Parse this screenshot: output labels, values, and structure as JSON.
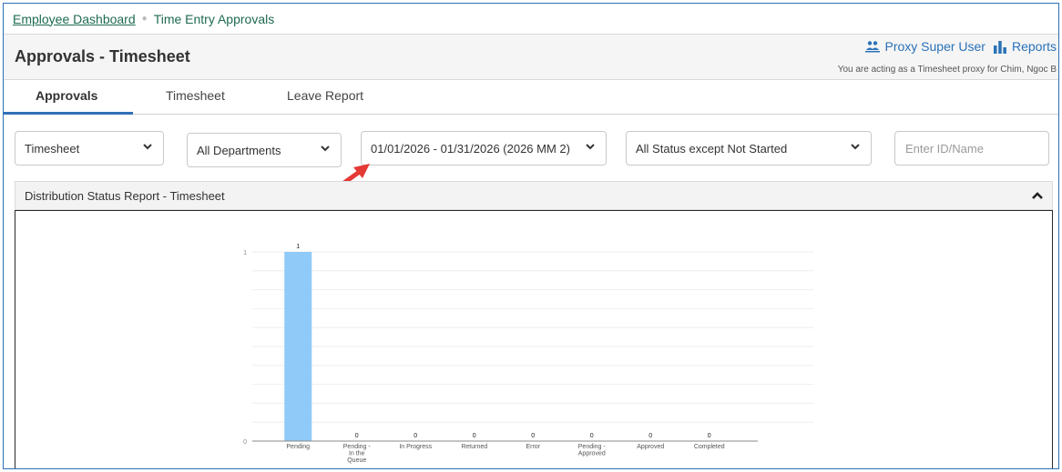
{
  "breadcrumb": {
    "items": [
      {
        "label": "Employee Dashboard"
      },
      {
        "label": "Time Entry Approvals"
      }
    ]
  },
  "header": {
    "title": "Approvals - Timesheet",
    "proxy_label": "Proxy Super User",
    "reports_label": "Reports",
    "proxy_note": "You are acting as a Timesheet proxy for Chim, Ngoc B",
    "icons": [
      "proxy-user-icon",
      "reports-chart-icon"
    ]
  },
  "tabs": [
    {
      "label": "Approvals",
      "active": true
    },
    {
      "label": "Timesheet",
      "active": false
    },
    {
      "label": "Leave Report",
      "active": false
    }
  ],
  "filters": {
    "type": "Timesheet",
    "department": "All Departments",
    "period": "01/01/2026 - 01/31/2026 (2026 MM 2)",
    "status": "All Status except Not Started",
    "search_placeholder": "Enter ID/Name"
  },
  "panel": {
    "title": "Distribution Status Report - Timesheet"
  },
  "colors": {
    "bar": "#90caf9",
    "link": "#1e6b50",
    "accent": "#2f6fb7",
    "annotation_arrow": "#e53935"
  },
  "chart_data": {
    "type": "bar",
    "categories": [
      "Pending",
      "Pending - In the Queue",
      "In Progress",
      "Returned",
      "Error",
      "Pending - Approved",
      "Approved",
      "Completed"
    ],
    "values": [
      1,
      0,
      0,
      0,
      0,
      0,
      0,
      0
    ],
    "ylim": [
      0,
      1
    ],
    "yticks": [
      0,
      1
    ],
    "grid": true,
    "title": "",
    "xlabel": "",
    "ylabel": ""
  }
}
